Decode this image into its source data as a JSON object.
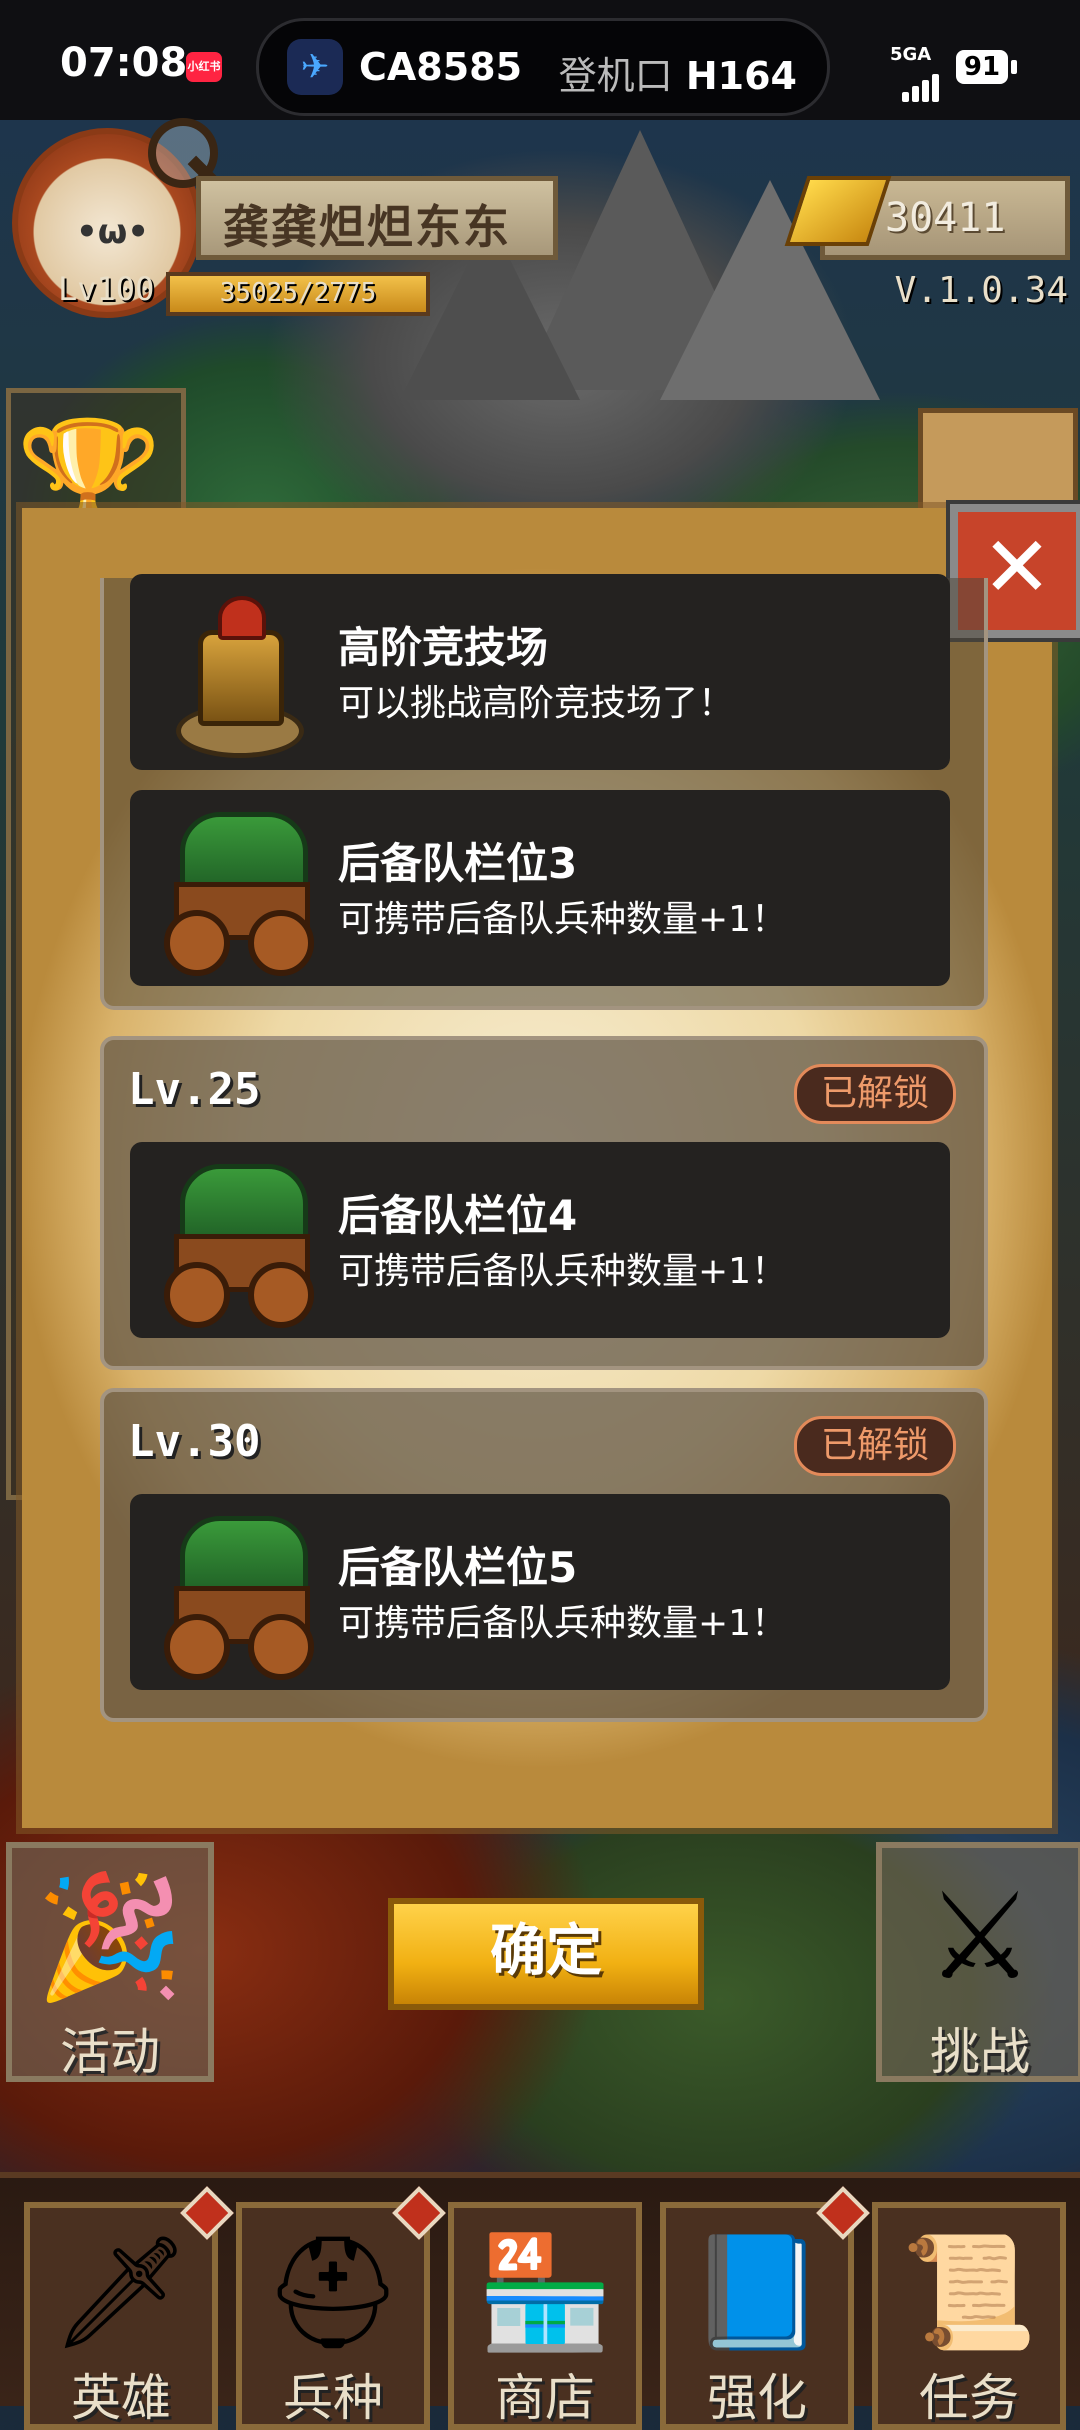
{
  "status_bar": {
    "time": "07:08",
    "app_badge": "小红书",
    "flight_number": "CA8585",
    "gate_label": "登机口",
    "gate_value": "H164",
    "network": "5GA",
    "battery": "91"
  },
  "player": {
    "name": "龚龚炟炟东东",
    "level": "Lv100",
    "xp_text": "35025/2775",
    "gold": "30411",
    "version": "V.1.0.34"
  },
  "rewards_panel": {
    "top_group": {
      "items": [
        {
          "title": "高阶竞技场",
          "desc": "可以挑战高阶竞技场了！",
          "icon": "knight-statue-icon"
        },
        {
          "title": "后备队栏位3",
          "desc": "可携带后备队兵种数量+1！",
          "icon": "wagon-icon"
        }
      ]
    },
    "groups": [
      {
        "level": "Lv.25",
        "status": "已解锁",
        "items": [
          {
            "title": "后备队栏位4",
            "desc": "可携带后备队兵种数量+1！",
            "icon": "wagon-icon"
          }
        ]
      },
      {
        "level": "Lv.30",
        "status": "已解锁",
        "items": [
          {
            "title": "后备队栏位5",
            "desc": "可携带后备队兵种数量+1！",
            "icon": "wagon-icon"
          }
        ]
      }
    ]
  },
  "confirm_label": "确定",
  "side_buttons": {
    "left_label": "活动",
    "right_label": "挑战"
  },
  "bottom_nav": [
    {
      "label": "英雄",
      "icon": "sword-icon"
    },
    {
      "label": "兵种",
      "icon": "helmet-icon"
    },
    {
      "label": "商店",
      "icon": "shop-icon"
    },
    {
      "label": "强化",
      "icon": "book-icon"
    },
    {
      "label": "任务",
      "icon": "scroll-icon"
    }
  ],
  "colors": {
    "unlock_badge": "#ee9a6a",
    "confirm_button": "#f1b012",
    "close_button": "#c7442a"
  }
}
